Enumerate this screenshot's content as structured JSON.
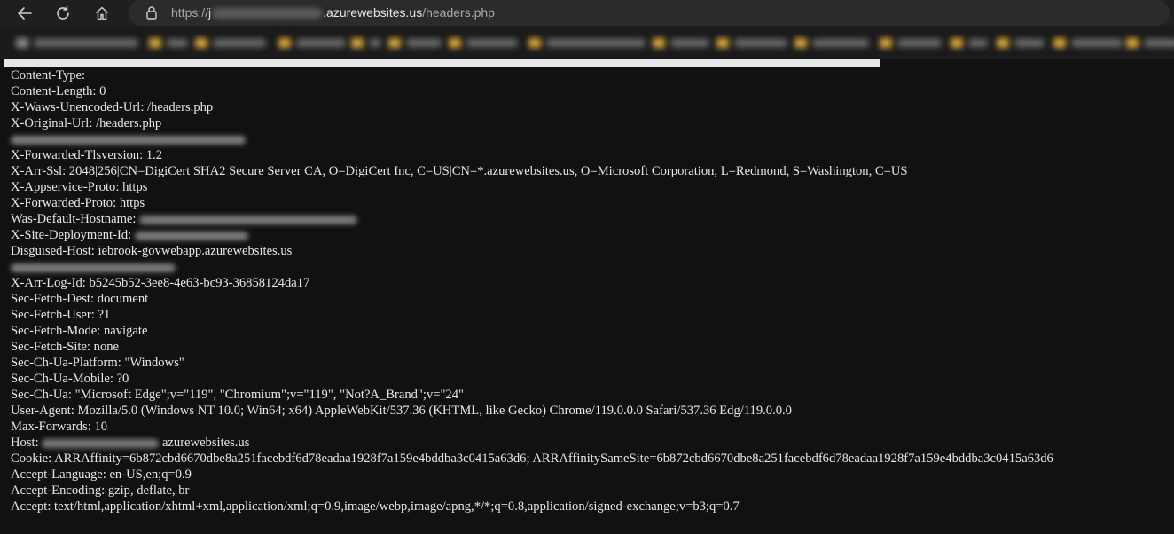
{
  "browser": {
    "url_scheme": "https://",
    "url_prefix": "j",
    "url_host": ".azurewebsites.us",
    "url_path": "/headers.php"
  },
  "headers": [
    {
      "name": "Content-Type:",
      "value": ""
    },
    {
      "name": "Content-Length:",
      "value": "0"
    },
    {
      "name": "X-Waws-Unencoded-Url:",
      "value": "/headers.php"
    },
    {
      "name": "X-Original-Url:",
      "value": "/headers.php"
    },
    {
      "name": "",
      "value": "",
      "redacted": true
    },
    {
      "name": "X-Forwarded-Tlsversion:",
      "value": "1.2"
    },
    {
      "name": "X-Arr-Ssl:",
      "value": "2048|256|CN=DigiCert SHA2 Secure Server CA, O=DigiCert Inc, C=US|CN=*.azurewebsites.us, O=Microsoft Corporation, L=Redmond, S=Washington, C=US"
    },
    {
      "name": "X-Appservice-Proto:",
      "value": "https"
    },
    {
      "name": "X-Forwarded-Proto:",
      "value": "https"
    },
    {
      "name": "Was-Default-Hostname:",
      "value": "",
      "redacted": true
    },
    {
      "name": "X-Site-Deployment-Id:",
      "value": "",
      "redacted": true
    },
    {
      "name": "Disguised-Host:",
      "value": "iebrook-govwebapp.azurewebsites.us"
    },
    {
      "name": "",
      "value": "",
      "redacted": true
    },
    {
      "name": "X-Arr-Log-Id:",
      "value": "b5245b52-3ee8-4e63-bc93-36858124da17"
    },
    {
      "name": "Sec-Fetch-Dest:",
      "value": "document"
    },
    {
      "name": "Sec-Fetch-User:",
      "value": "?1"
    },
    {
      "name": "Sec-Fetch-Mode:",
      "value": "navigate"
    },
    {
      "name": "Sec-Fetch-Site:",
      "value": "none"
    },
    {
      "name": "Sec-Ch-Ua-Platform:",
      "value": "\"Windows\""
    },
    {
      "name": "Sec-Ch-Ua-Mobile:",
      "value": "?0"
    },
    {
      "name": "Sec-Ch-Ua:",
      "value": "\"Microsoft Edge\";v=\"119\", \"Chromium\";v=\"119\", \"Not?A_Brand\";v=\"24\""
    },
    {
      "name": "User-Agent:",
      "value": "Mozilla/5.0 (Windows NT 10.0; Win64; x64) AppleWebKit/537.36 (KHTML, like Gecko) Chrome/119.0.0.0 Safari/537.36 Edg/119.0.0.0"
    },
    {
      "name": "Max-Forwards:",
      "value": "10"
    },
    {
      "name": "Host:",
      "value": "azurewebsites.us",
      "redacted": true
    },
    {
      "name": "Cookie:",
      "value": "ARRAffinity=6b872cbd6670dbe8a251facebdf6d78eadaa1928f7a159e4bddba3c0415a63d6; ARRAffinitySameSite=6b872cbd6670dbe8a251facebdf6d78eadaa1928f7a159e4bddba3c0415a63d6"
    },
    {
      "name": "Accept-Language:",
      "value": "en-US,en;q=0.9"
    },
    {
      "name": "Accept-Encoding:",
      "value": "gzip, deflate, br"
    },
    {
      "name": "Accept:",
      "value": "text/html,application/xhtml+xml,application/xml;q=0.9,image/webp,image/apng,*/*;q=0.8,application/signed-exchange;v=b3;q=0.7"
    }
  ],
  "colors": {
    "background": "#111111",
    "text": "#e8e8e8",
    "toolbar": "#1f1f1f",
    "addressbar": "#2b2b2b"
  }
}
